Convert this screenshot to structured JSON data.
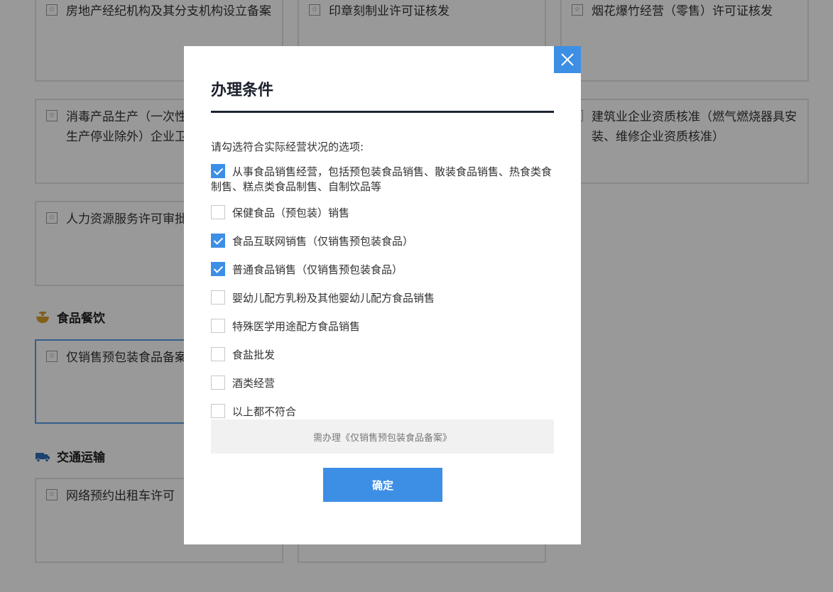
{
  "background": {
    "cards": [
      {
        "id": "c1",
        "text": "房地产经纪机构及其分支机构设立备案"
      },
      {
        "id": "c2",
        "text": "印章刻制业许可证核发"
      },
      {
        "id": "c3",
        "text": "烟花爆竹经营（零售）许可证核发"
      },
      {
        "id": "c4",
        "text": "消毒产品生产（一次性使用医疗用品的生产停业除外）企业卫生许可"
      },
      {
        "id": "c5",
        "text": "建筑业企业资质核准（燃气燃烧器具安装、维修企业资质核准）"
      },
      {
        "id": "c6",
        "text": "人力资源服务许可审批"
      },
      {
        "id": "c7",
        "text": "仅销售预包装食品备案"
      },
      {
        "id": "c8",
        "text": "网络预约出租车许可"
      }
    ],
    "sections": {
      "food": "食品餐饮",
      "transport": "交通运输"
    }
  },
  "modal": {
    "title": "办理条件",
    "prompt": "请勾选符合实际经营状况的选项:",
    "options": [
      {
        "label": "从事食品销售经营，包括预包装食品销售、散装食品销售、热食类食制售、糕点类食品制售、自制饮品等",
        "checked": true
      },
      {
        "label": "保健食品（预包装）销售",
        "checked": false
      },
      {
        "label": "食品互联网销售（仅销售预包装食品）",
        "checked": true
      },
      {
        "label": "普通食品销售（仅销售预包装食品）",
        "checked": true
      },
      {
        "label": "婴幼儿配方乳粉及其他婴幼儿配方食品销售",
        "checked": false
      },
      {
        "label": "特殊医学用途配方食品销售",
        "checked": false
      },
      {
        "label": "食盐批发",
        "checked": false
      },
      {
        "label": "酒类经营",
        "checked": false
      },
      {
        "label": "以上都不符合",
        "checked": false
      }
    ],
    "result": "需办理《仅销售预包装食品备案》",
    "confirm_label": "确定"
  },
  "colors": {
    "accent": "#3d8fe6",
    "overlay": "rgba(0,0,0,0.4)",
    "title_rule": "#1d2430"
  },
  "icons": {
    "card": "item-doc-icon",
    "food": "food-bowl-icon",
    "transport": "truck-icon",
    "close": "close-icon"
  }
}
